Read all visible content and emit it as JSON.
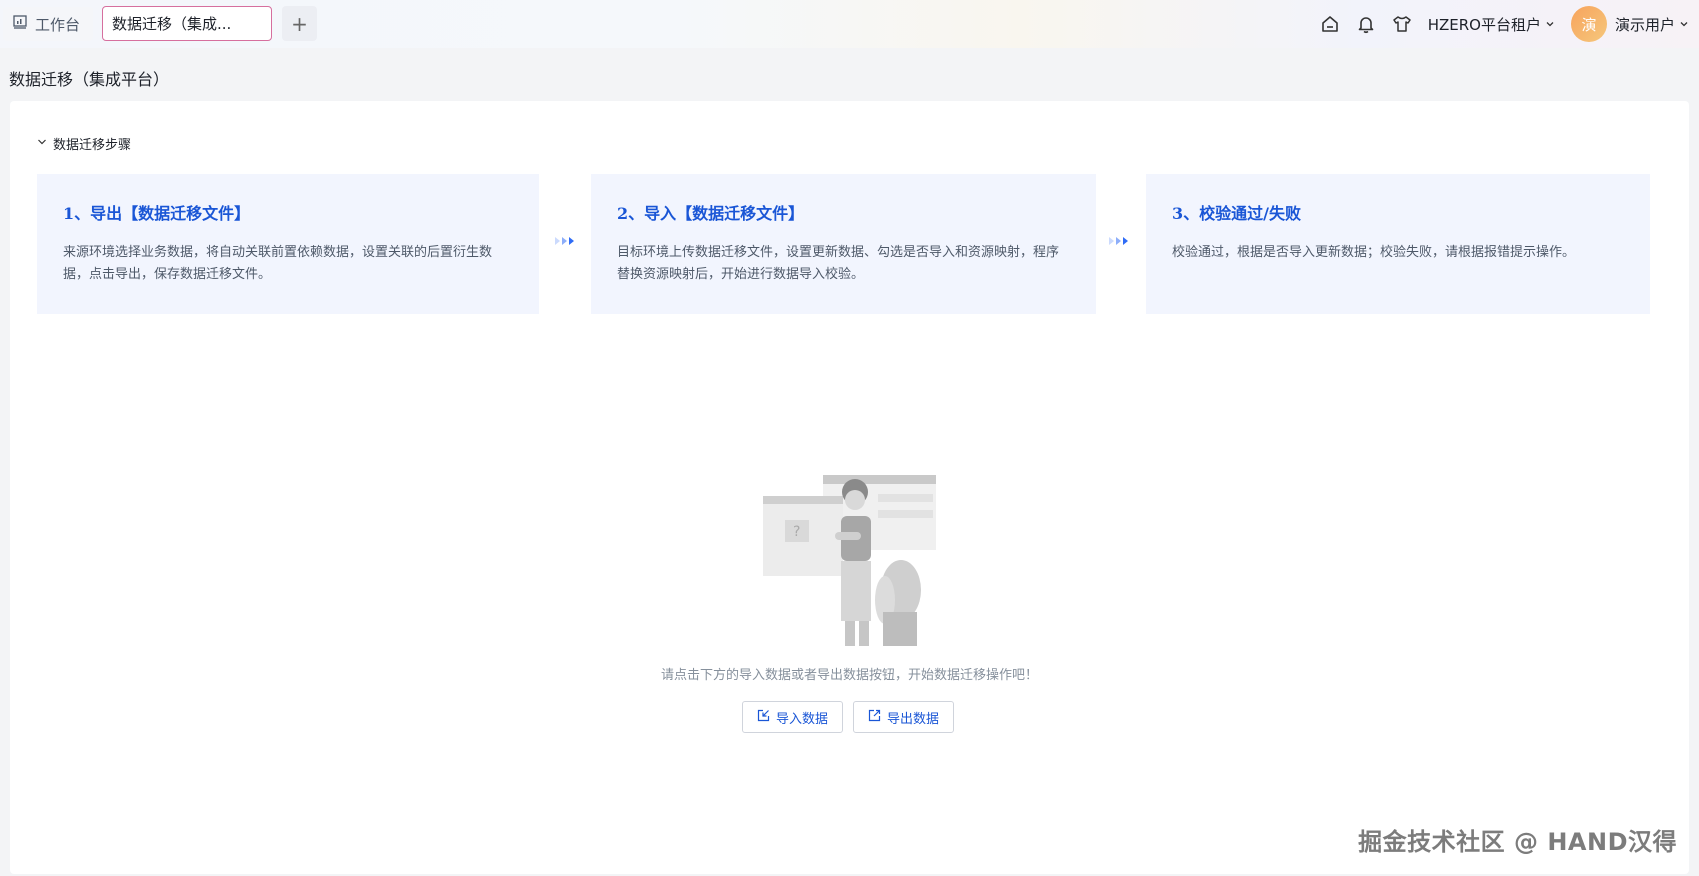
{
  "tabs": {
    "home_label": "工作台",
    "active_label": "数据迁移（集成...",
    "add_label": "+"
  },
  "header": {
    "tenant": "HZERO平台租户",
    "avatar_text": "演",
    "username": "演示用户"
  },
  "page": {
    "title": "数据迁移（集成平台）",
    "steps_toggle": "数据迁移步骤"
  },
  "steps": [
    {
      "title": "1、导出【数据迁移文件】",
      "desc": "来源环境选择业务数据，将自动关联前置依赖数据，设置关联的后置衍生数据，点击导出，保存数据迁移文件。"
    },
    {
      "title": "2、导入【数据迁移文件】",
      "desc": "目标环境上传数据迁移文件，设置更新数据、勾选是否导入和资源映射，程序替换资源映射后，开始进行数据导入校验。"
    },
    {
      "title": "3、校验通过/失败",
      "desc": "校验通过，根据是否导入更新数据；校验失败，请根据报错提示操作。"
    }
  ],
  "empty": {
    "text": "请点击下方的导入数据或者导出数据按钮，开始数据迁移操作吧！",
    "import_label": "导入数据",
    "export_label": "导出数据"
  },
  "watermark": "掘金技术社区 @ HAND汉得",
  "colors": {
    "accent": "#1a56d6",
    "step_bg": "#f2f5fe"
  }
}
